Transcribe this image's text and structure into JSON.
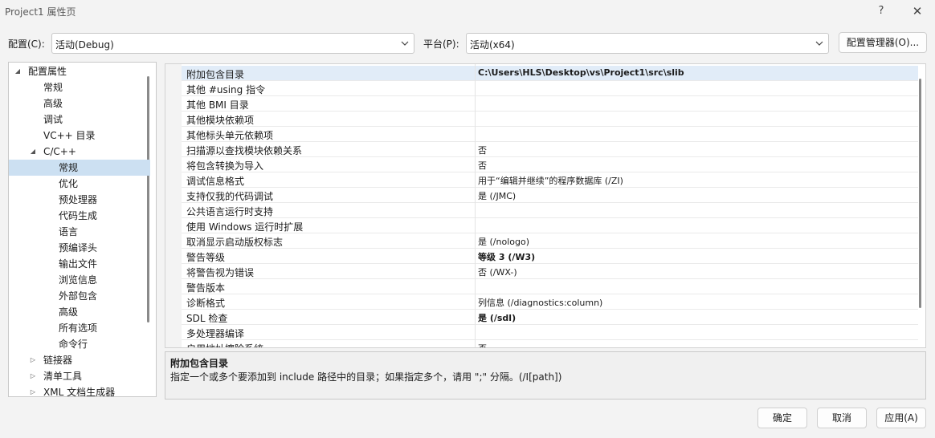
{
  "window": {
    "title": "Project1 属性页",
    "help": "?",
    "close": "✕"
  },
  "config": {
    "label": "配置(C):",
    "value": "活动(Debug)"
  },
  "platform": {
    "label": "平台(P):",
    "value": "活动(x64)"
  },
  "config_manager_label": "配置管理器(O)...",
  "tree": {
    "items": [
      {
        "label": "配置属性",
        "expander": "◢"
      },
      {
        "label": "常规",
        "expander": ""
      },
      {
        "label": "高级",
        "expander": ""
      },
      {
        "label": "调试",
        "expander": ""
      },
      {
        "label": "VC++ 目录",
        "expander": ""
      },
      {
        "label": "C/C++",
        "expander": "◢"
      },
      {
        "label": "常规",
        "expander": "",
        "selected": true
      },
      {
        "label": "优化",
        "expander": ""
      },
      {
        "label": "预处理器",
        "expander": ""
      },
      {
        "label": "代码生成",
        "expander": ""
      },
      {
        "label": "语言",
        "expander": ""
      },
      {
        "label": "预编译头",
        "expander": ""
      },
      {
        "label": "输出文件",
        "expander": ""
      },
      {
        "label": "浏览信息",
        "expander": ""
      },
      {
        "label": "外部包含",
        "expander": ""
      },
      {
        "label": "高级",
        "expander": ""
      },
      {
        "label": "所有选项",
        "expander": ""
      },
      {
        "label": "命令行",
        "expander": ""
      },
      {
        "label": "链接器",
        "expander": "▷"
      },
      {
        "label": "清单工具",
        "expander": "▷"
      },
      {
        "label": "XML 文档生成器",
        "expander": "▷"
      }
    ]
  },
  "properties": [
    {
      "name": "附加包含目录",
      "value": "C:\\Users\\HLS\\Desktop\\vs\\Project1\\src\\slib",
      "bold": true,
      "selected": true
    },
    {
      "name": "其他 #using 指令",
      "value": "",
      "bold": false
    },
    {
      "name": "其他 BMI 目录",
      "value": "",
      "bold": false
    },
    {
      "name": "其他模块依赖项",
      "value": "",
      "bold": false
    },
    {
      "name": "其他标头单元依赖项",
      "value": "",
      "bold": false
    },
    {
      "name": "扫描源以查找模块依赖关系",
      "value": "否",
      "bold": false
    },
    {
      "name": "将包含转换为导入",
      "value": "否",
      "bold": false
    },
    {
      "name": "调试信息格式",
      "value": "用于“编辑并继续”的程序数据库 (/ZI)",
      "bold": false
    },
    {
      "name": "支持仅我的代码调试",
      "value": "是 (/JMC)",
      "bold": false
    },
    {
      "name": "公共语言运行时支持",
      "value": "",
      "bold": false
    },
    {
      "name": "使用 Windows 运行时扩展",
      "value": "",
      "bold": false
    },
    {
      "name": "取消显示启动版权标志",
      "value": "是 (/nologo)",
      "bold": false
    },
    {
      "name": "警告等级",
      "value": "等级 3 (/W3)",
      "bold": true
    },
    {
      "name": "将警告视为错误",
      "value": "否 (/WX-)",
      "bold": false
    },
    {
      "name": "警告版本",
      "value": "",
      "bold": false
    },
    {
      "name": "诊断格式",
      "value": "列信息 (/diagnostics:column)",
      "bold": false
    },
    {
      "name": "SDL 检查",
      "value": "是 (/sdl)",
      "bold": true
    },
    {
      "name": "多处理器编译",
      "value": "",
      "bold": false
    },
    {
      "name": "启用地址擦除系统",
      "value": "否",
      "bold": false
    }
  ],
  "description": {
    "title": "附加包含目录",
    "text": "指定一个或多个要添加到 include 路径中的目录；如果指定多个，请用 \";\" 分隔。(/I[path])"
  },
  "buttons": {
    "ok": "确定",
    "cancel": "取消",
    "apply": "应用(A)"
  }
}
